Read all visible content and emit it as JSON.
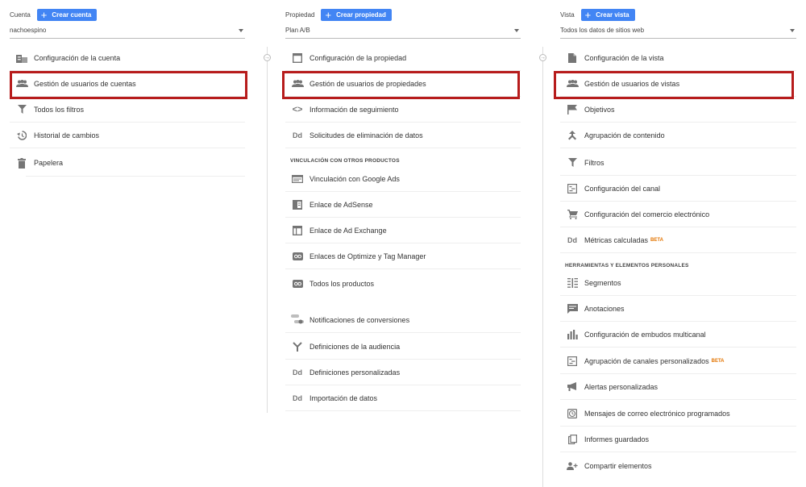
{
  "account": {
    "label": "Cuenta",
    "create": "Crear cuenta",
    "selected": "nachoespino",
    "items": [
      {
        "label": "Configuración de la cuenta",
        "icon": "building-icon"
      },
      {
        "label": "Gestión de usuarios de cuentas",
        "icon": "people-icon"
      },
      {
        "label": "Todos los filtros",
        "icon": "filter-icon"
      },
      {
        "label": "Historial de cambios",
        "icon": "history-icon"
      },
      {
        "label": "Papelera",
        "icon": "trash-icon"
      }
    ]
  },
  "property": {
    "label": "Propiedad",
    "create": "Crear propiedad",
    "selected": "Plan A/B",
    "items": [
      {
        "label": "Configuración de la propiedad",
        "icon": "window-icon"
      },
      {
        "label": "Gestión de usuarios de propiedades",
        "icon": "people-icon"
      },
      {
        "label": "Información de seguimiento",
        "icon": "code-icon"
      },
      {
        "label": "Solicitudes de eliminación de datos",
        "icon": "dd-icon"
      }
    ],
    "section_title": "VINCULACIÓN CON OTROS PRODUCTOS",
    "links": [
      {
        "label": "Vinculación con Google Ads",
        "icon": "ads-icon"
      },
      {
        "label": "Enlace de AdSense",
        "icon": "adsense-icon"
      },
      {
        "label": "Enlace de Ad Exchange",
        "icon": "adexchange-icon"
      },
      {
        "label": "Enlaces de Optimize y Tag Manager",
        "icon": "link-icon"
      },
      {
        "label": "Todos los productos",
        "icon": "link-icon"
      }
    ],
    "more": [
      {
        "label": "Notificaciones de conversiones",
        "icon": "toggle-icon"
      },
      {
        "label": "Definiciones de la audiencia",
        "icon": "fork-icon"
      },
      {
        "label": "Definiciones personalizadas",
        "icon": "dd-icon"
      },
      {
        "label": "Importación de datos",
        "icon": "dd-icon"
      }
    ]
  },
  "view": {
    "label": "Vista",
    "create": "Crear vista",
    "selected": "Todos los datos de sitios web",
    "items": [
      {
        "label": "Configuración de la vista",
        "icon": "document-icon"
      },
      {
        "label": "Gestión de usuarios de vistas",
        "icon": "people-icon"
      },
      {
        "label": "Objetivos",
        "icon": "flag-icon"
      },
      {
        "label": "Agrupación de contenido",
        "icon": "merge-icon"
      },
      {
        "label": "Filtros",
        "icon": "filter-icon"
      },
      {
        "label": "Configuración del canal",
        "icon": "channel-icon"
      },
      {
        "label": "Configuración del comercio electrónico",
        "icon": "cart-icon"
      },
      {
        "label": "Métricas calculadas",
        "icon": "dd-icon",
        "badge": "BETA"
      }
    ],
    "section_title": "HERRAMIENTAS Y ELEMENTOS PERSONALES",
    "tools": [
      {
        "label": "Segmentos",
        "icon": "segments-icon"
      },
      {
        "label": "Anotaciones",
        "icon": "comment-icon"
      },
      {
        "label": "Configuración de embudos multicanal",
        "icon": "bars-icon"
      },
      {
        "label": "Agrupación de canales personalizados",
        "icon": "channel-icon",
        "badge": "BETA"
      },
      {
        "label": "Alertas personalizadas",
        "icon": "megaphone-icon"
      },
      {
        "label": "Mensajes de correo electrónico programados",
        "icon": "clock-icon"
      },
      {
        "label": "Informes guardados",
        "icon": "copy-icon"
      },
      {
        "label": "Compartir elementos",
        "icon": "person-add-icon"
      }
    ]
  },
  "colors": {
    "accent": "#4285f4",
    "highlight": "#b71c1c",
    "beta": "#e37400"
  }
}
